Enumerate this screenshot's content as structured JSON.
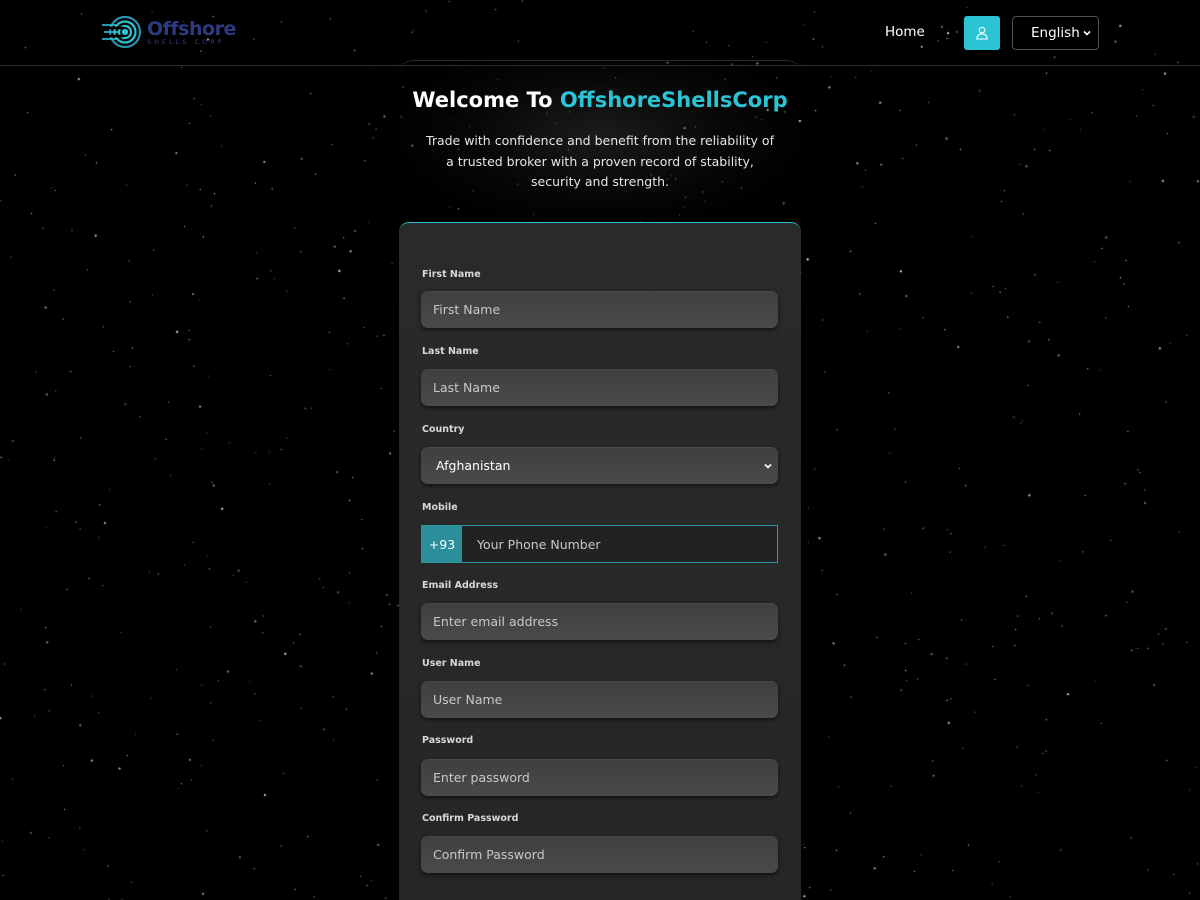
{
  "header": {
    "logo": {
      "word": "Offshore",
      "sub": "SHELLS CORP"
    },
    "nav_home": "Home",
    "user_icon": "user-icon",
    "language": "English"
  },
  "hero": {
    "title_prefix": "Welcome To ",
    "title_brand": "OffshoreShellsCorp",
    "description": "Trade with confidence and benefit from the reliability of a trusted broker with a proven record of stability, security and strength."
  },
  "form": {
    "first_name": {
      "label": "First Name",
      "placeholder": "First Name"
    },
    "last_name": {
      "label": "Last Name",
      "placeholder": "Last Name"
    },
    "country": {
      "label": "Country",
      "value": "Afghanistan"
    },
    "mobile": {
      "label": "Mobile",
      "code": "+93",
      "placeholder": "Your Phone Number"
    },
    "email": {
      "label": "Email Address",
      "placeholder": "Enter email address"
    },
    "username": {
      "label": "User Name",
      "placeholder": "User Name"
    },
    "password": {
      "label": "Password",
      "placeholder": "Enter password"
    },
    "confirm_password": {
      "label": "Confirm Password",
      "placeholder": "Confirm Password"
    }
  },
  "colors": {
    "accent": "#2bc4d5",
    "background": "#000000",
    "card": "#2a2a2a",
    "logo": "#2e3a80"
  }
}
